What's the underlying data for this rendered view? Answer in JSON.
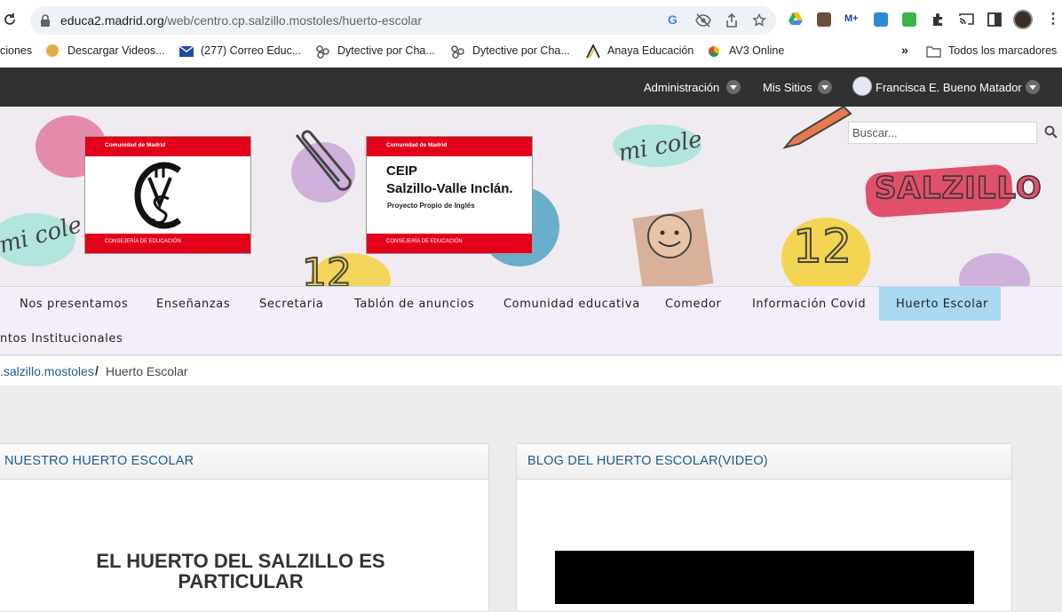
{
  "browser": {
    "url_domain": "educa2.madrid.org",
    "url_path": "/web/centro.cp.salzillo.mostoles/huerto-escolar",
    "bookmarks": [
      {
        "label": "ciones",
        "icon": "folder-icon"
      },
      {
        "label": "Descargar Videos...",
        "icon": "download-icon"
      },
      {
        "label": "(277) Correo Educ...",
        "icon": "mail-icon"
      },
      {
        "label": "Dytective por Cha...",
        "icon": "dytective-icon"
      },
      {
        "label": "Dytective por Cha...",
        "icon": "dytective-icon"
      },
      {
        "label": "Anaya Educación",
        "icon": "anaya-icon"
      },
      {
        "label": "AV3 Online",
        "icon": "av3-icon"
      }
    ],
    "more_bookmarks": "»",
    "all_bookmarks": "Todos los marcadores"
  },
  "topbar": {
    "admin": "Administración",
    "my_sites": "Mis Sitios",
    "user": "Francisca E. Bueno Matador"
  },
  "banner": {
    "logo1_header": "Comunidad de Madrid",
    "logo1_footer": "CONSEJERÍA DE EDUCACIÓN",
    "logo2_header": "Comunidad de Madrid",
    "logo2_line1": "CEIP",
    "logo2_line2": "Salzillo-Valle Inclán.",
    "logo2_line3": "Proyecto Propio de Inglés",
    "logo2_footer": "CONSEJERÍA DE EDUCACIÓN",
    "doodle_mi_cole_1": "mi cole",
    "doodle_mi_cole_2": "mi cole",
    "doodle_salzillo": "SALZILLO",
    "doodle_12": "12",
    "search_placeholder": "Buscar..."
  },
  "nav": {
    "items": [
      "Nos presentamos",
      "Enseñanzas",
      "Secretaria",
      "Tablón de anuncios",
      "Comunidad educativa",
      "Comedor",
      "Información Covid",
      "Huerto Escolar",
      "ntos Institucionales"
    ],
    "active": "Huerto Escolar"
  },
  "breadcrumb": {
    "parent": ".salzillo.mostoles",
    "separator": "/",
    "current": "Huerto Escolar"
  },
  "portlets": {
    "left_title": "NUESTRO HUERTO ESCOLAR",
    "left_article_title": "EL HUERTO DEL SALZILLO ES PARTICULAR",
    "right_title": "BLOG DEL HUERTO ESCOLAR(VIDEO)"
  },
  "colors": {
    "topbar": "#313131",
    "nav_bg": "#f3eef7",
    "nav_active": "#a8d8f2",
    "link": "#1a5b8c",
    "madrid_red": "#e3001b"
  }
}
